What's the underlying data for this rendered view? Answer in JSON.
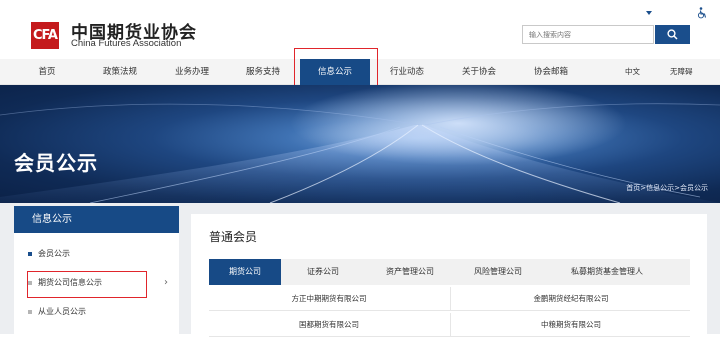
{
  "logo": {
    "glyph": "CFA",
    "cn": "中国期货业协会",
    "en": "China Futures Association"
  },
  "search": {
    "placeholder": "输入搜索内容"
  },
  "nav": {
    "items": [
      "首页",
      "政策法规",
      "业务办理",
      "服务支持",
      "信息公示",
      "行业动态",
      "关于协会",
      "协会邮箱"
    ],
    "active": "信息公示",
    "language": "中文",
    "accessibility": "无障碍"
  },
  "banner": {
    "title": "会员公示",
    "breadcrumb": "首页>信息公示>会员公示"
  },
  "sidebar": {
    "title": "信息公示",
    "items": [
      "会员公示",
      "期货公司信息公示",
      "从业人员公示"
    ]
  },
  "main": {
    "title": "普通会员",
    "tabs": [
      "期货公司",
      "证券公司",
      "资产管理公司",
      "风险管理公司",
      "私募期货基金管理人"
    ],
    "rows": [
      [
        "方正中期期货有限公司",
        "金鹏期货经纪有限公司"
      ],
      [
        "国都期货有限公司",
        "中粮期货有限公司"
      ]
    ]
  },
  "colors": {
    "brand_blue": "#174a86",
    "logo_red": "#c41a1c",
    "highlight_red": "#e0252b"
  }
}
